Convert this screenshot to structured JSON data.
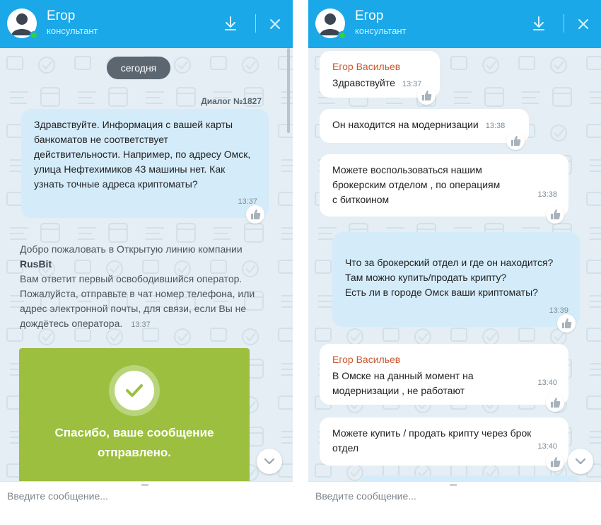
{
  "left": {
    "header": {
      "name": "Егор",
      "role": "консультант"
    },
    "date_pill": "сегодня",
    "dialog_label": "Диалог №1827",
    "messages": [
      {
        "text": "Здравствуйте. Информация с вашей карты банкоматов не соответствует действительности. Например, по адресу Омск, улица Нефтехимиков 43 машины нет. Как узнать точные адреса криптоматы?",
        "time": "13:37"
      }
    ],
    "welcome": {
      "line1": "Добро пожаловать в Открытую линию компании ",
      "company": "RusBit",
      "line2": "Вам ответит первый освободившийся оператор. Пожалуйста, отправьте в чат номер телефона, или адрес электронной почты, для связи, если Вы не дождётесь оператора.",
      "time": "13:37"
    },
    "success_text": "Спасибо, ваше сообщение отправлено.",
    "composer_placeholder": "Введите сообщение..."
  },
  "right": {
    "header": {
      "name": "Егор",
      "role": "консультант"
    },
    "messages": [
      {
        "sender": "Егор Васильев",
        "text": "Здравствуйте",
        "time": "13:37"
      },
      {
        "text": "Он находится на модернизации",
        "time": "13:38"
      },
      {
        "text": "Можете воспользоваться нашим брокерским отделом , по операциям с биткоином",
        "time": "13:38"
      },
      {
        "text": "Что за брокерский отдел и где он находится? Там можно купить/продать крипту?\nЕсть ли в городе Омск ваши криптоматы?",
        "time": "13:39"
      },
      {
        "sender": "Егор Васильев",
        "text": "В Омске на данный момент на модернизации , не работают",
        "time": "13:40"
      },
      {
        "text": "Можете купить / продать крипту через брок отдел",
        "time": "13:40"
      }
    ],
    "composer_placeholder": "Введите сообщение..."
  },
  "colors": {
    "header_bg": "#1aa8e8",
    "incoming_bubble": "#ffffff",
    "outgoing_bubble": "#d4ecfa",
    "sender_name": "#c9572f",
    "success_bg": "#9cbf3f",
    "online": "#35cf3f"
  },
  "icons": {
    "avatar": "user-silhouette-icon",
    "download": "download-arrow-icon",
    "close": "close-icon",
    "like": "thumbs-up-icon",
    "success": "checkmark-icon",
    "scroll": "chevron-down-icon"
  }
}
